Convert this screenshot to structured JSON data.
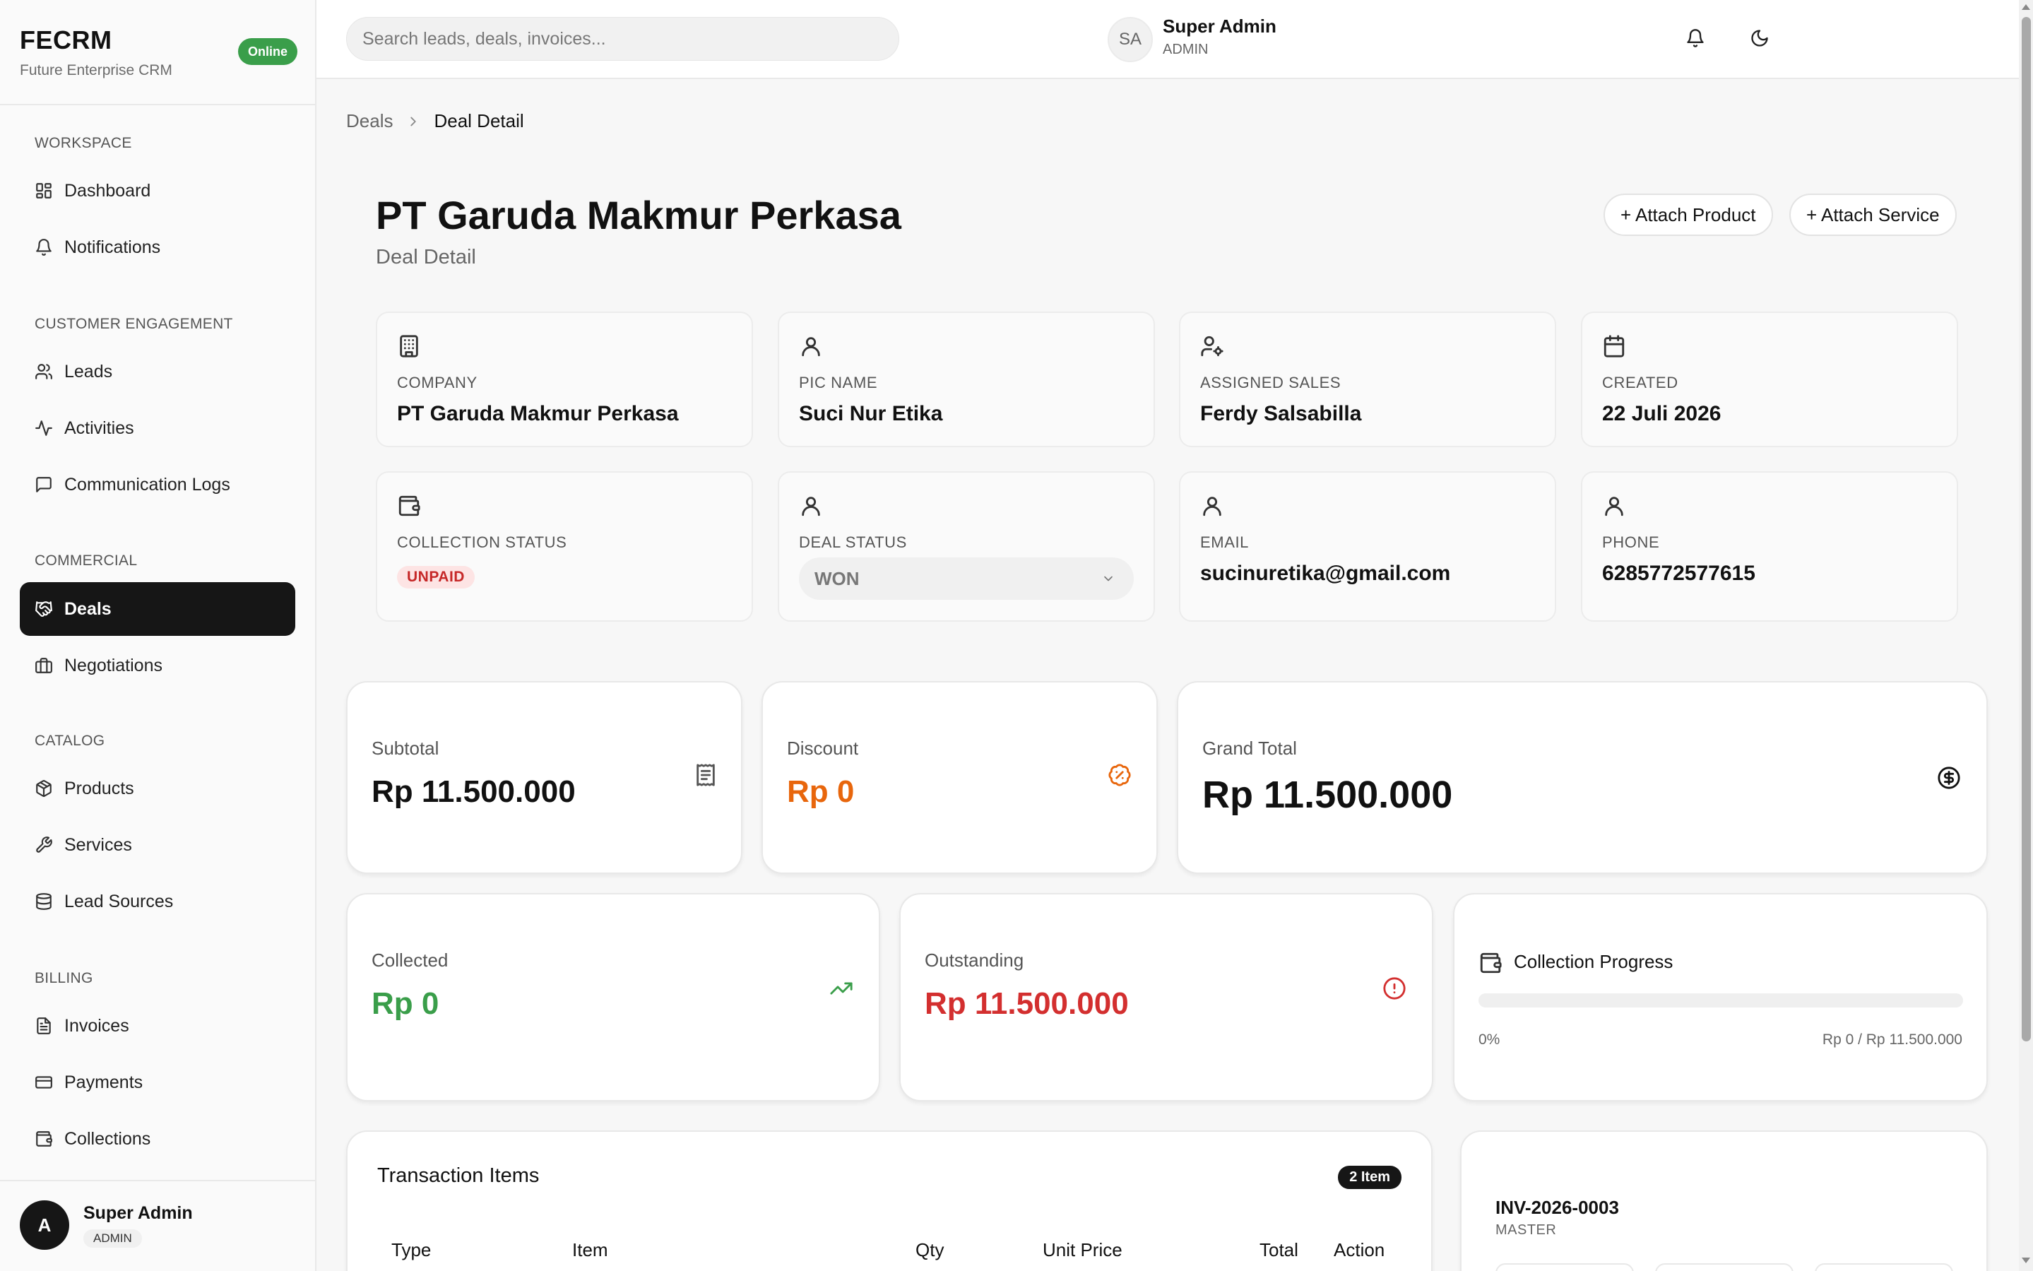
{
  "brand": {
    "name": "FECRM",
    "subtitle": "Future Enterprise CRM",
    "status": "Online"
  },
  "sidebar": {
    "sections": [
      "WORKSPACE",
      "CUSTOMER ENGAGEMENT",
      "COMMERCIAL",
      "CATALOG",
      "BILLING"
    ],
    "items": [
      {
        "label": "Dashboard",
        "icon": "grid-icon"
      },
      {
        "label": "Notifications",
        "icon": "bell-icon"
      },
      {
        "label": "Leads",
        "icon": "users-icon"
      },
      {
        "label": "Activities",
        "icon": "activity-icon"
      },
      {
        "label": "Communication Logs",
        "icon": "message-icon"
      },
      {
        "label": "Deals",
        "icon": "handshake-icon",
        "active": true
      },
      {
        "label": "Negotiations",
        "icon": "briefcase-icon"
      },
      {
        "label": "Products",
        "icon": "package-icon"
      },
      {
        "label": "Services",
        "icon": "wrench-icon"
      },
      {
        "label": "Lead Sources",
        "icon": "database-icon"
      },
      {
        "label": "Invoices",
        "icon": "file-text-icon"
      },
      {
        "label": "Payments",
        "icon": "credit-card-icon"
      },
      {
        "label": "Collections",
        "icon": "wallet-icon"
      }
    ],
    "user": {
      "initial": "A",
      "name": "Super Admin",
      "role": "ADMIN"
    }
  },
  "topbar": {
    "search_placeholder": "Search leads, deals, invoices...",
    "user": {
      "initials": "SA",
      "name": "Super Admin",
      "role": "ADMIN"
    }
  },
  "breadcrumb": {
    "parent": "Deals",
    "current": "Deal Detail"
  },
  "header": {
    "title": "PT Garuda Makmur Perkasa",
    "subtitle": "Deal Detail",
    "attach_product": "+ Attach Product",
    "attach_service": "+ Attach Service"
  },
  "info": {
    "company": {
      "label": "COMPANY",
      "value": "PT Garuda Makmur Perkasa"
    },
    "pic": {
      "label": "PIC NAME",
      "value": "Suci Nur Etika"
    },
    "sales": {
      "label": "ASSIGNED SALES",
      "value": "Ferdy Salsabilla"
    },
    "created": {
      "label": "CREATED",
      "value": "22 Juli 2026"
    },
    "collection": {
      "label": "COLLECTION STATUS",
      "value": "UNPAID"
    },
    "deal_status": {
      "label": "DEAL STATUS",
      "value": "WON"
    },
    "email": {
      "label": "EMAIL",
      "value": "sucinuretika@gmail.com"
    },
    "phone": {
      "label": "PHONE",
      "value": "6285772577615"
    }
  },
  "stats": {
    "subtotal": {
      "label": "Subtotal",
      "value": "Rp 11.500.000"
    },
    "discount": {
      "label": "Discount",
      "value": "Rp 0"
    },
    "grand_total": {
      "label": "Grand Total",
      "value": "Rp 11.500.000"
    },
    "collected": {
      "label": "Collected",
      "value": "Rp 0"
    },
    "outstanding": {
      "label": "Outstanding",
      "value": "Rp 11.500.000"
    }
  },
  "progress": {
    "title": "Collection Progress",
    "percent_label": "0%",
    "amount_label": "Rp 0 / Rp 11.500.000",
    "fraction": 0
  },
  "transactions": {
    "title": "Transaction Items",
    "count": "2 Item",
    "columns": [
      "Type",
      "Item",
      "Qty",
      "Unit Price",
      "Total",
      "Action"
    ]
  },
  "invoice": {
    "number": "INV-2026-0003",
    "type": "MASTER"
  },
  "colors": {
    "accent_dark": "#161616",
    "online": "#3a9e4a",
    "discount": "#e8660c",
    "collected": "#3a9e4a",
    "outstanding": "#d32f2f",
    "unpaid_badge": "#fde4e4"
  }
}
